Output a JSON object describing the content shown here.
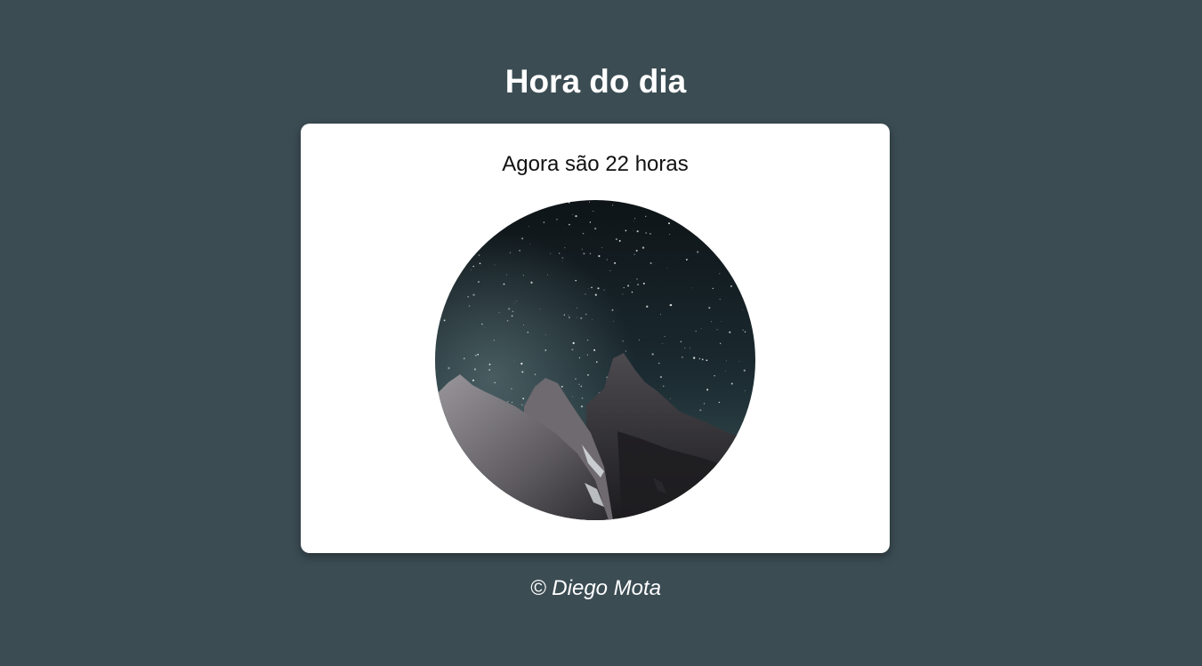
{
  "page": {
    "title": "Hora do dia",
    "message": "Agora são 22 horas",
    "footer": "© Diego Mota"
  },
  "image": {
    "description_icon": "night-mountain-image"
  },
  "colors": {
    "background": "#3b4c53",
    "card": "#ffffff",
    "title_text": "#ffffff",
    "message_text": "#111111"
  }
}
